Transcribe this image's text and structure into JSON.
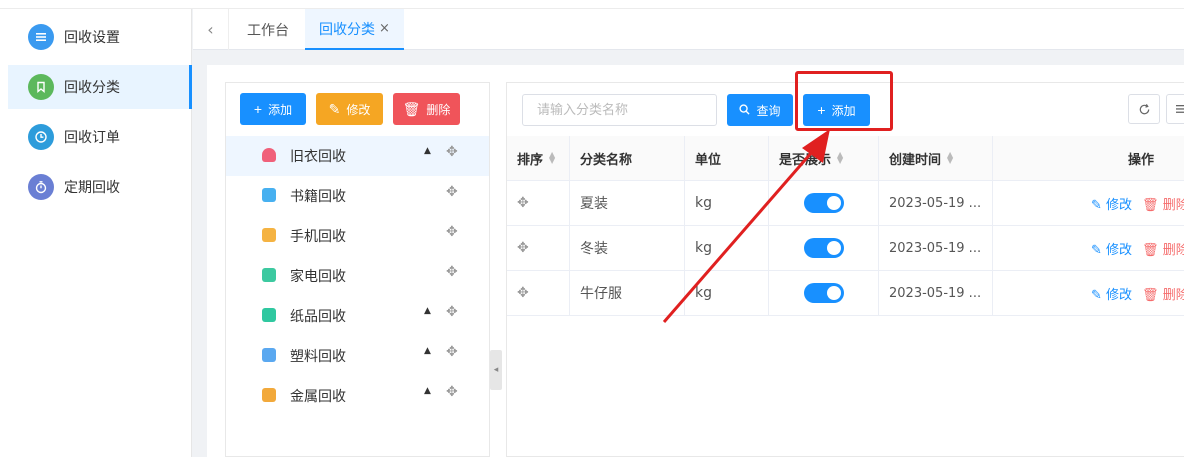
{
  "sidebar": {
    "items": [
      {
        "label": "回收设置",
        "icon": "list-icon",
        "color": "#3a9af0"
      },
      {
        "label": "回收分类",
        "icon": "bookmark-icon",
        "color": "#5cb85c",
        "active": true
      },
      {
        "label": "回收订单",
        "icon": "clock-icon",
        "color": "#2d9cdb"
      },
      {
        "label": "定期回收",
        "icon": "timer-icon",
        "color": "#6a7fd4"
      }
    ]
  },
  "tabs": {
    "back_icon": "‹",
    "items": [
      {
        "label": "工作台"
      },
      {
        "label": "回收分类",
        "active": true,
        "close": "×"
      }
    ]
  },
  "tree": {
    "buttons": {
      "add": "添加",
      "edit": "修改",
      "delete": "删除"
    },
    "items": [
      {
        "label": "旧衣回收",
        "icon_color": "#f0607a",
        "caret": "▲",
        "selected": true
      },
      {
        "label": "书籍回收",
        "icon_color": "#47b0f0",
        "caret": ""
      },
      {
        "label": "手机回收",
        "icon_color": "#f5b342",
        "caret": ""
      },
      {
        "label": "家电回收",
        "icon_color": "#3cc9a0",
        "caret": ""
      },
      {
        "label": "纸品回收",
        "icon_color": "#2fc8a0",
        "caret": "▲"
      },
      {
        "label": "塑料回收",
        "icon_color": "#5aa8f0",
        "caret": "▲"
      },
      {
        "label": "金属回收",
        "icon_color": "#f2a93b",
        "caret": "▲"
      }
    ],
    "collapse_icon": "◂"
  },
  "toolbar": {
    "search_placeholder": "请输入分类名称",
    "query": "查询",
    "add": "添加"
  },
  "table": {
    "headers": {
      "sort": "排序",
      "name": "分类名称",
      "unit": "单位",
      "display": "是否展示",
      "created": "创建时间",
      "actions": "操作"
    },
    "rows": [
      {
        "name": "夏装",
        "unit": "kg",
        "display": true,
        "created": "2023-05-19 ...",
        "edit": "修改",
        "delete": "删除"
      },
      {
        "name": "冬装",
        "unit": "kg",
        "display": true,
        "created": "2023-05-19 ...",
        "edit": "修改",
        "delete": "删除"
      },
      {
        "name": "牛仔服",
        "unit": "kg",
        "display": true,
        "created": "2023-05-19 ...",
        "edit": "修改",
        "delete": "删除"
      }
    ]
  },
  "colors": {
    "primary": "#1890ff",
    "warning": "#f5a623",
    "danger": "#f56c6c",
    "annotation": "#e02020"
  }
}
